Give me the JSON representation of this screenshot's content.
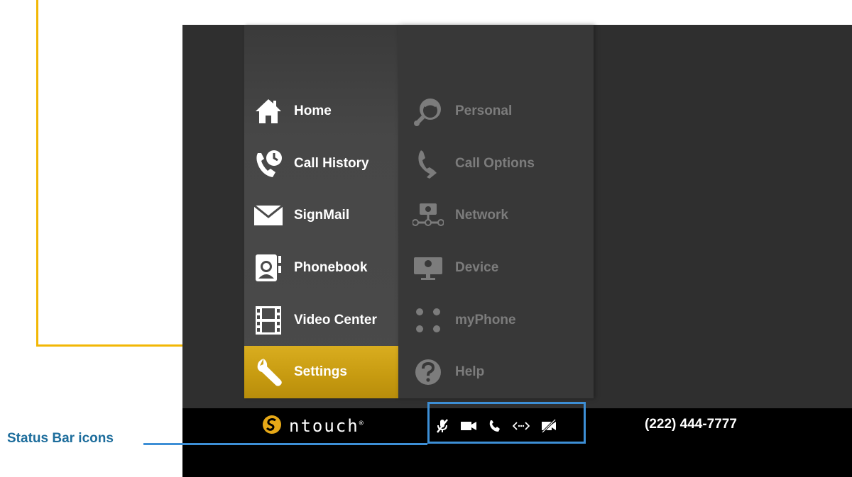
{
  "main_menu": {
    "items": [
      {
        "label": "Home",
        "icon": "home-icon"
      },
      {
        "label": "Call History",
        "icon": "call-history-icon"
      },
      {
        "label": "SignMail",
        "icon": "signmail-icon"
      },
      {
        "label": "Phonebook",
        "icon": "phonebook-icon"
      },
      {
        "label": "Video Center",
        "icon": "video-center-icon"
      },
      {
        "label": "Settings",
        "icon": "settings-icon",
        "active": true
      }
    ]
  },
  "sub_menu": {
    "items": [
      {
        "label": "Personal",
        "icon": "personal-icon"
      },
      {
        "label": "Call Options",
        "icon": "call-options-icon"
      },
      {
        "label": "Network",
        "icon": "network-icon"
      },
      {
        "label": "Device",
        "icon": "device-icon"
      },
      {
        "label": "myPhone",
        "icon": "myphone-icon"
      },
      {
        "label": "Help",
        "icon": "help-icon"
      }
    ]
  },
  "status_bar": {
    "brand": "ntouch",
    "brand_mark": "®",
    "phone_number": "(222) 444-7777",
    "icons": [
      "mic-off-icon",
      "video-camera-icon",
      "phone-icon",
      "network-arrows-icon",
      "video-privacy-off-icon"
    ]
  },
  "annotations": {
    "status_bar_label": "Status Bar icons"
  },
  "colors": {
    "accent": "#c9a012",
    "annotation_yellow": "#f2b705",
    "annotation_blue": "#3d8fd6",
    "annotation_text": "#1d6d9c"
  }
}
